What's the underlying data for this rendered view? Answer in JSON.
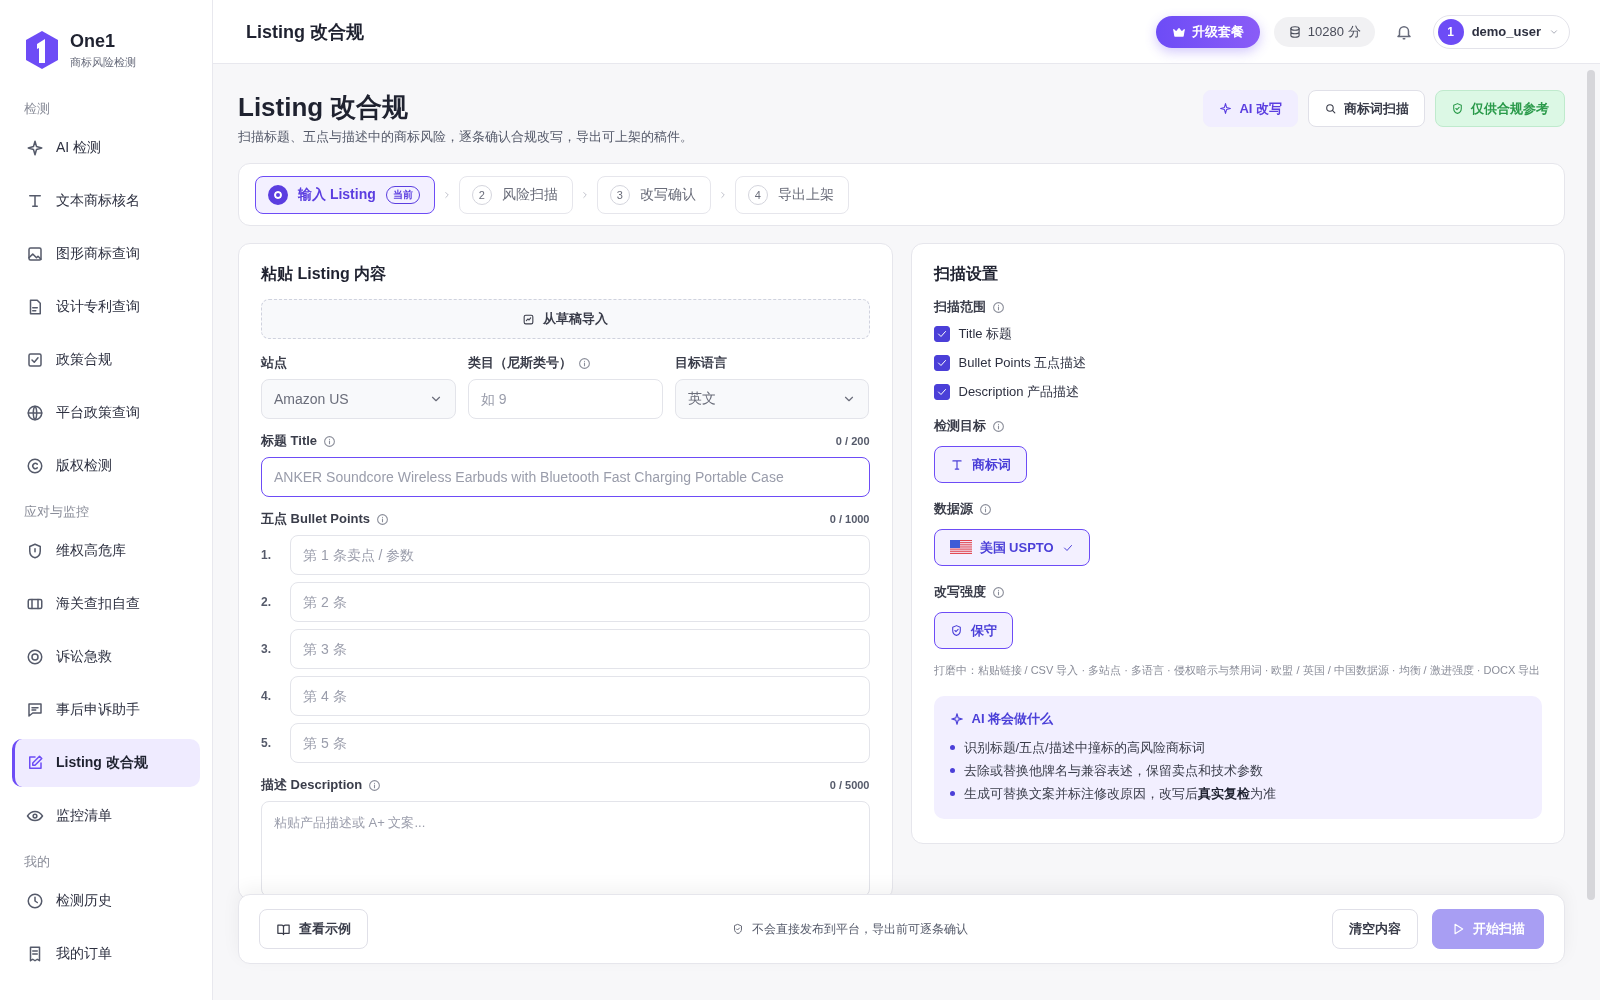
{
  "brand": {
    "name": "One1",
    "tagline": "商标风险检测"
  },
  "sidebar": {
    "sections": [
      {
        "title": "检测",
        "items": [
          {
            "label": "AI 检测",
            "selected": false
          },
          {
            "label": "文本商标核名",
            "selected": false
          },
          {
            "label": "图形商标查询",
            "selected": false
          },
          {
            "label": "设计专利查询",
            "selected": false
          },
          {
            "label": "政策合规",
            "selected": false
          },
          {
            "label": "平台政策查询",
            "selected": false
          },
          {
            "label": "版权检测",
            "selected": false
          }
        ]
      },
      {
        "title": "应对与监控",
        "items": [
          {
            "label": "维权高危库",
            "selected": false
          },
          {
            "label": "海关查扣自查",
            "selected": false
          },
          {
            "label": "诉讼急救",
            "selected": false
          },
          {
            "label": "事后申诉助手",
            "selected": false
          },
          {
            "label": "Listing 改合规",
            "selected": true
          },
          {
            "label": "监控清单",
            "selected": false
          }
        ]
      },
      {
        "title": "我的",
        "items": [
          {
            "label": "检测历史",
            "selected": false
          },
          {
            "label": "我的订单",
            "selected": false
          }
        ]
      }
    ]
  },
  "header": {
    "title": "Listing 改合规",
    "upgrade": "升级套餐",
    "points": "10280 分",
    "user": {
      "avatar": "1",
      "name": "demo_user"
    }
  },
  "page": {
    "title": "Listing 改合规",
    "subtitle": "扫描标题、五点与描述中的商标风险，逐条确认合规改写，导出可上架的稿件。",
    "actions": [
      {
        "label": "AI 改写",
        "kind": "ai"
      },
      {
        "label": "商标词扫描",
        "kind": "scan"
      },
      {
        "label": "仅供合规参考",
        "kind": "notice"
      }
    ]
  },
  "steps": [
    {
      "label": "输入 Listing",
      "badge": "当前",
      "selected": true
    },
    {
      "number": "2",
      "label": "风险扫描",
      "selected": false
    },
    {
      "number": "3",
      "label": "改写确认",
      "selected": false
    },
    {
      "number": "4",
      "label": "导出上架",
      "selected": false
    }
  ],
  "content_form": {
    "title": "粘贴 Listing 内容",
    "import_button": "从草稿导入",
    "fields": [
      {
        "label": "站点",
        "kind": "select",
        "value": "Amazon US",
        "info": false
      },
      {
        "label": "类目（尼斯类号）",
        "kind": "input",
        "placeholder": "如 9",
        "info": true
      },
      {
        "label": "目标语言",
        "kind": "select",
        "value": "英文",
        "info": false
      }
    ],
    "title_field": {
      "label": "标题 Title",
      "counter": "0 / 200",
      "placeholder": "ANKER Soundcore Wireless Earbuds with Bluetooth Fast Charging Portable Case",
      "focused": true
    },
    "bullets": {
      "label": "五点 Bullet Points",
      "counter": "0 / 1000",
      "items": [
        {
          "number": "1.",
          "placeholder": "第 1 条卖点 / 参数"
        },
        {
          "number": "2.",
          "placeholder": "第 2 条"
        },
        {
          "number": "3.",
          "placeholder": "第 3 条"
        },
        {
          "number": "4.",
          "placeholder": "第 4 条"
        },
        {
          "number": "5.",
          "placeholder": "第 5 条"
        }
      ]
    },
    "description": {
      "label": "描述 Description",
      "counter": "0 / 5000",
      "placeholder": "粘贴产品描述或 A+ 文案..."
    }
  },
  "settings": {
    "title": "扫描设置",
    "scope": {
      "label": "扫描范围",
      "options": [
        {
          "label": "Title 标题",
          "checked": true
        },
        {
          "label": "Bullet Points 五点描述",
          "checked": true
        },
        {
          "label": "Description 产品描述",
          "checked": true
        }
      ]
    },
    "groups": [
      {
        "label": "检测目标",
        "kind": "target",
        "chips": [
          {
            "label": "商标词",
            "selected": true
          }
        ]
      },
      {
        "label": "数据源",
        "kind": "source",
        "chips": [
          {
            "label": "美国 USPTO",
            "selected": true
          }
        ]
      },
      {
        "label": "改写强度",
        "kind": "strength",
        "chips": [
          {
            "label": "保守",
            "selected": true
          }
        ]
      }
    ],
    "roadmap": "打磨中：粘贴链接 / CSV 导入 · 多站点 · 多语言 · 侵权暗示与禁用词 · 欧盟 / 英国 / 中国数据源 · 均衡 / 激进强度 · DOCX 导出",
    "ai_box": {
      "title": "AI 将会做什么",
      "items": [
        "识别标题/五点/描述中撞标的高风险商标词",
        "去除或替换他牌名与兼容表述，保留卖点和技术参数",
        "生成可替换文案并标注修改原因，改写后**真实复检**为准"
      ]
    }
  },
  "footer": {
    "example_button": "查看示例",
    "note": "不会直接发布到平台，导出前可逐条确认",
    "clear_button": "清空内容",
    "start_button": {
      "label": "开始扫描",
      "disabled": true
    }
  }
}
